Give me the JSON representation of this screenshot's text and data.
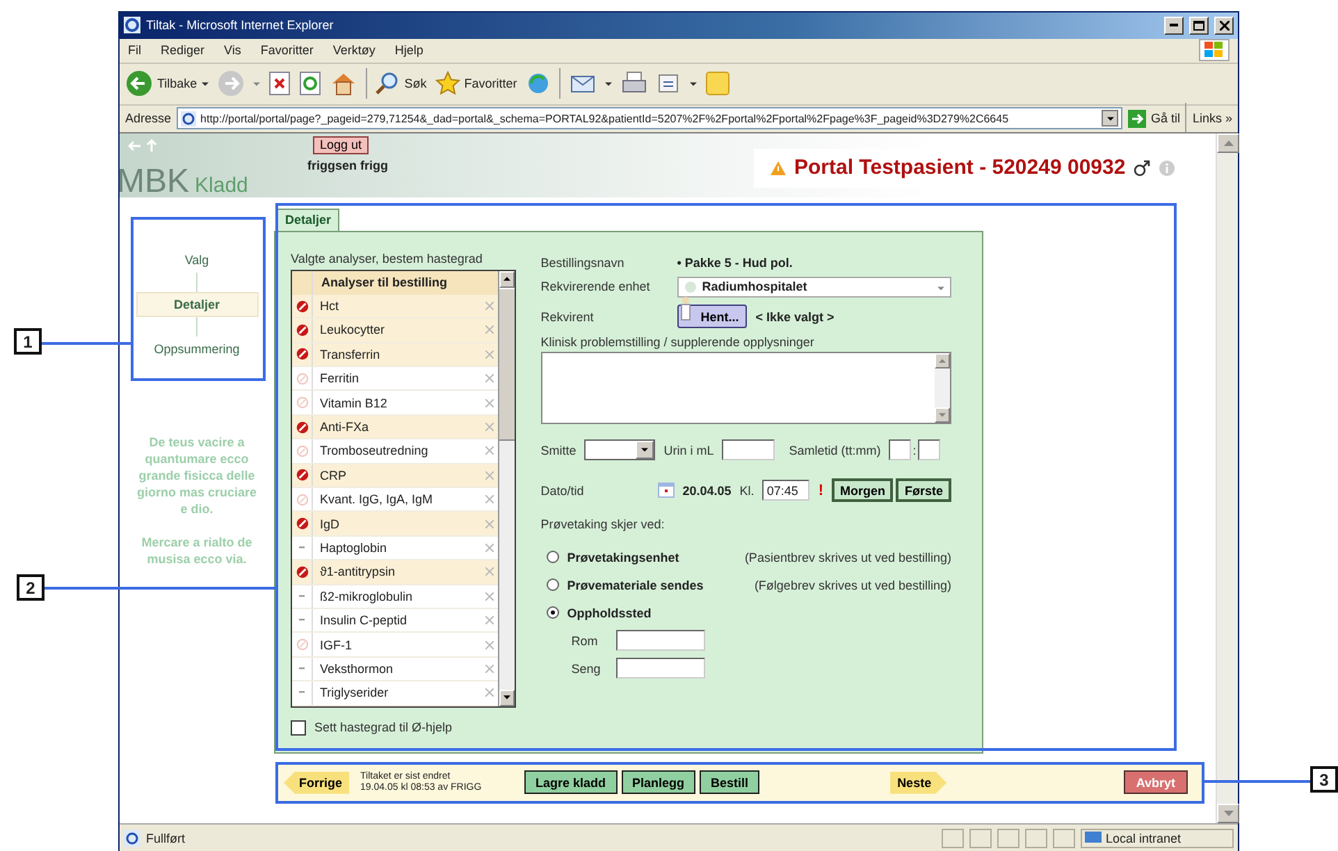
{
  "window": {
    "title": "Tiltak - Microsoft Internet Explorer"
  },
  "menu": [
    "Fil",
    "Rediger",
    "Vis",
    "Favoritter",
    "Verktøy",
    "Hjelp"
  ],
  "toolbar": {
    "back": "Tilbake",
    "search": "Søk",
    "favorites": "Favoritter"
  },
  "address": {
    "label": "Adresse",
    "url": "http://portal/portal/page?_pageid=279,71254&_dad=portal&_schema=PORTAL92&patientId=5207%2F%2Fportal%2Fportal%2Fpage%3F_pageid%3D279%2C6645",
    "go": "Gå til",
    "links": "Links »"
  },
  "header": {
    "logout": "Logg ut",
    "user": "friggsen frigg",
    "logo": "MBK",
    "subtitle": "Kladd",
    "patient": "Portal Testpasient - 520249 00932"
  },
  "steps": [
    {
      "label": "Valg",
      "selected": false
    },
    {
      "label": "Detaljer",
      "selected": true
    },
    {
      "label": "Oppsummering",
      "selected": false
    }
  ],
  "info_texts": [
    "De teus vacire a quantumare ecco grande fisicca delle giorno mas cruciare e dio.",
    "Mercare a rialto de musisa ecco via."
  ],
  "tabs": [
    {
      "label": "Detaljer",
      "selected": true
    }
  ],
  "analyses": {
    "caption": "Valgte analyser, bestem hastegrad",
    "header": "Analyser til bestilling",
    "rows": [
      {
        "name": "Hct",
        "kind": "urgent"
      },
      {
        "name": "Leukocytter",
        "kind": "urgent"
      },
      {
        "name": "Transferrin",
        "kind": "urgent"
      },
      {
        "name": "Ferritin",
        "kind": "normal"
      },
      {
        "name": "Vitamin B12",
        "kind": "normal"
      },
      {
        "name": "Anti-FXa",
        "kind": "urgent"
      },
      {
        "name": "Tromboseutredning",
        "kind": "normal"
      },
      {
        "name": "CRP",
        "kind": "urgent"
      },
      {
        "name": "Kvant. IgG, IgA, IgM",
        "kind": "normal"
      },
      {
        "name": "IgD",
        "kind": "urgent"
      },
      {
        "name": "Haptoglobin",
        "kind": "fixed"
      },
      {
        "name": "ϑ1-antitrypsin",
        "kind": "urgent"
      },
      {
        "name": "ß2-mikroglobulin",
        "kind": "fixed"
      },
      {
        "name": "Insulin C-peptid",
        "kind": "fixed"
      },
      {
        "name": "IGF-1",
        "kind": "normal"
      },
      {
        "name": "Veksthormon",
        "kind": "fixed"
      },
      {
        "name": "Triglyserider",
        "kind": "fixed"
      }
    ]
  },
  "urgent_all": {
    "label": "Sett hastegrad til Ø-hjelp",
    "checked": false
  },
  "form": {
    "order_name_label": "Bestillingsnavn",
    "order_name": "• Pakke 5 - Hud pol.",
    "unit_label": "Rekvirerende enhet",
    "unit": "Radiumhospitalet",
    "requester_label": "Rekvirent",
    "fetch": "Hent...",
    "requester": "< Ikke valgt >",
    "clinical_label": "Klinisk problemstilling / supplerende opplysninger",
    "infection_label": "Smitte",
    "urine_label": "Urin i mL",
    "collect_label": "Samletid (tt:mm)",
    "collect_sep": ":",
    "date_label": "Dato/tid",
    "date": "20.04.05",
    "time_label": "Kl.",
    "time": "07:45",
    "warning": "!",
    "morning": "Morgen",
    "first": "Første"
  },
  "sampling": {
    "caption": "Prøvetaking skjer ved:",
    "options": [
      {
        "label": "Prøvetakingsenhet",
        "note": "(Pasientbrev skrives ut ved bestilling)",
        "selected": false
      },
      {
        "label": "Prøvemateriale sendes",
        "note": "(Følgebrev skrives ut ved bestilling)",
        "selected": false
      },
      {
        "label": "Oppholdssted",
        "selected": true
      }
    ],
    "fields": [
      "Rom",
      "Seng"
    ]
  },
  "footer": {
    "prev": "Forrige",
    "changed": [
      "Tiltaket er sist endret",
      "19.04.05 kl 08:53 av FRIGG"
    ],
    "actions": [
      "Lagre kladd",
      "Planlegg",
      "Bestill"
    ],
    "next": "Neste",
    "cancel": "Avbryt"
  },
  "status_bar": {
    "text": "Fullført",
    "zone": "Local intranet"
  },
  "callouts": [
    "1",
    "2",
    "3"
  ]
}
